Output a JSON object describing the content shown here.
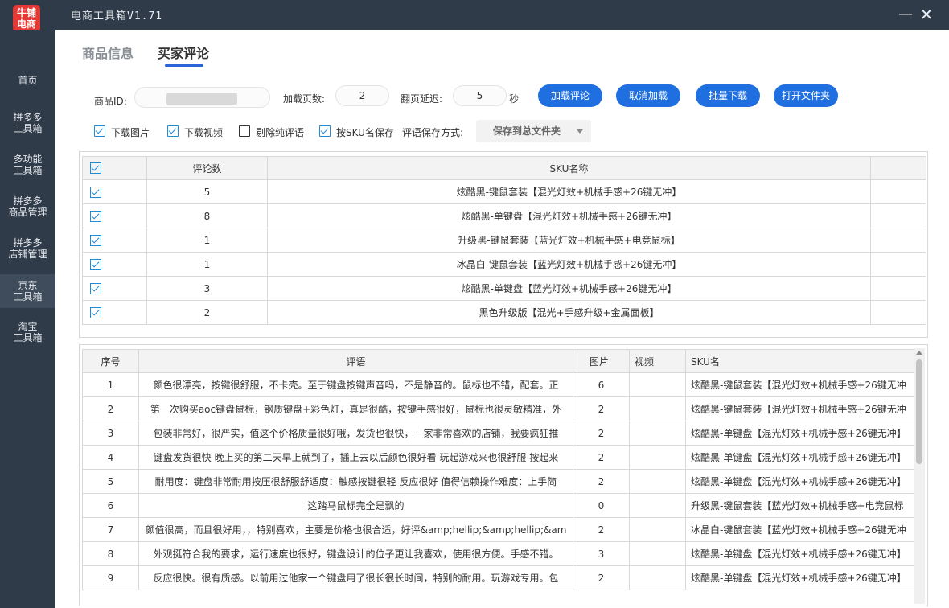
{
  "app": {
    "logo_text": "牛铺电商",
    "title": "电商工具箱V1.71",
    "minimize_icon": "minimize-icon",
    "close_icon": "close-icon"
  },
  "sidebar": {
    "items": [
      {
        "label": "首页"
      },
      {
        "label": "拼多多\n工具箱"
      },
      {
        "label": "多功能\n工具箱"
      },
      {
        "label": "拼多多\n商品管理"
      },
      {
        "label": "拼多多\n店铺管理"
      },
      {
        "label": "京东\n工具箱",
        "active": true
      },
      {
        "label": "淘宝\n工具箱"
      }
    ]
  },
  "tabs": [
    {
      "label": "商品信息"
    },
    {
      "label": "买家评论",
      "active": true
    }
  ],
  "form": {
    "product_id_label": "商品ID:",
    "pages_label": "加载页数:",
    "pages_value": "2",
    "delay_label": "翻页延迟:",
    "delay_value": "5",
    "delay_unit": "秒",
    "buttons": {
      "load": "加载评论",
      "cancel": "取消加载",
      "batch_download": "批量下载",
      "open_folder": "打开文件夹"
    },
    "options": {
      "download_images": "下载图片",
      "download_videos": "下载视频",
      "remove_text_only": "剔除纯评语",
      "save_by_sku": "按SKU名保存",
      "save_mode_label": "评语保存方式:",
      "save_mode_value": "保存到总文件夹"
    }
  },
  "sku_table": {
    "headers": [
      "评论数",
      "SKU名称"
    ],
    "rows": [
      {
        "count": "5",
        "name": "炫酷黑-键鼠套装【混光灯效+机械手感+26键无冲】"
      },
      {
        "count": "8",
        "name": "炫酷黑-单键盘【混光灯效+机械手感+26键无冲】"
      },
      {
        "count": "1",
        "name": "升级黑-键鼠套装【蓝光灯效+机械手感+电竞鼠标】"
      },
      {
        "count": "1",
        "name": "冰晶白-键鼠套装【蓝光灯效+机械手感+26键无冲】"
      },
      {
        "count": "3",
        "name": "炫酷黑-单键盘【蓝光灯效+机械手感+26键无冲】"
      },
      {
        "count": "2",
        "name": "黑色升级版【混光+手感升级+金属面板】"
      }
    ]
  },
  "review_table": {
    "headers": [
      "序号",
      "评语",
      "图片",
      "视频",
      "SKU名"
    ],
    "rows": [
      {
        "no": "1",
        "text": "颜色很漂亮，按键很舒服，不卡壳。至于键盘按键声音吗，不是静音的。鼠标也不错，配套。正",
        "img": "6",
        "video": "",
        "sku": "炫酷黑-键鼠套装【混光灯效+机械手感+26键无冲"
      },
      {
        "no": "2",
        "text": "第一次购买aoc键盘鼠标，钢质键盘+彩色灯，真是很酷，按键手感很好，鼠标也很灵敏精准，外",
        "img": "2",
        "video": "",
        "sku": "炫酷黑-键鼠套装【混光灯效+机械手感+26键无冲"
      },
      {
        "no": "3",
        "text": "包装非常好，很严实，值这个价格质量很好哦，发货也很快，一家非常喜欢的店铺，我要疯狂推",
        "img": "2",
        "video": "",
        "sku": "炫酷黑-单键盘【混光灯效+机械手感+26键无冲】"
      },
      {
        "no": "4",
        "text": "键盘发货很快 晚上买的第二天早上就到了，插上去以后颜色很好看 玩起游戏来也很舒服 按起来",
        "img": "2",
        "video": "",
        "sku": "炫酷黑-单键盘【混光灯效+机械手感+26键无冲】"
      },
      {
        "no": "5",
        "text": "耐用度：键盘非常耐用按压很舒服舒适度：触感按键很轻 反应很好 值得信赖操作难度：上手简",
        "img": "2",
        "video": "",
        "sku": "炫酷黑-单键盘【混光灯效+机械手感+26键无冲】"
      },
      {
        "no": "6",
        "text": "这踏马鼠标完全是飘的",
        "img": "0",
        "video": "",
        "sku": "升级黑-键鼠套装【蓝光灯效+机械手感+电竞鼠标"
      },
      {
        "no": "7",
        "text": "颜值很高，而且很好用，，特别喜欢，主要是价格也很合适，好评&amp;hellip;&amp;hellip;&am",
        "img": "2",
        "video": "",
        "sku": "冰晶白-键鼠套装【蓝光灯效+机械手感+26键无冲"
      },
      {
        "no": "8",
        "text": "外观挺符合我的要求，运行速度也很好，键盘设计的位子更让我喜欢，使用很方便。手感不错。",
        "img": "3",
        "video": "",
        "sku": "炫酷黑-单键盘【混光灯效+机械手感+26键无冲】"
      },
      {
        "no": "9",
        "text": "反应很快。很有质感。以前用过他家一个键盘用了很长很长时间，特别的耐用。玩游戏专用。包",
        "img": "2",
        "video": "",
        "sku": "炫酷黑-单键盘【混光灯效+机械手感+26键无冲】"
      }
    ]
  },
  "colors": {
    "sidebar_bg": "#2f3b49",
    "accent": "#1f6fe0",
    "checkbox": "#1f8ad8"
  }
}
